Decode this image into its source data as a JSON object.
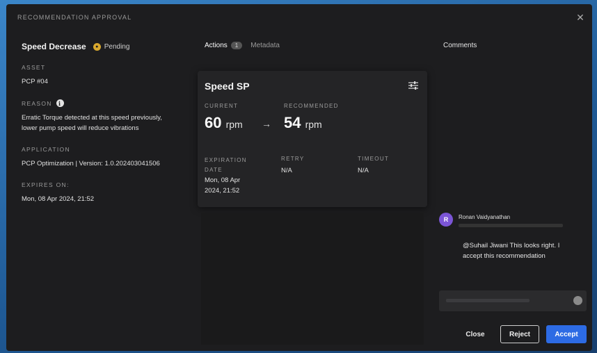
{
  "modal": {
    "title": "RECOMMENDATION APPROVAL",
    "close_icon": "close-icon"
  },
  "recommendation": {
    "name": "Speed Decrease",
    "status": "Pending"
  },
  "details": {
    "asset_label": "ASSET",
    "asset_value": "PCP #04",
    "reason_label": "REASON",
    "reason_value": "Erratic Torque detected at this speed previously, lower pump speed will reduce vibrations",
    "application_label": "APPLICATION",
    "application_value": "PCP Optimization | Version: 1.0.20240304​1506",
    "expires_label": "EXPIRES ON:",
    "expires_value": "Mon, 08 Apr 2024, 21:52"
  },
  "tabs": [
    {
      "label": "Actions",
      "count": "1"
    },
    {
      "label": "Metadata"
    }
  ],
  "action_card": {
    "title": "Speed SP",
    "current_label": "CURRENT",
    "current_value": "60",
    "current_unit": "rpm",
    "arrow": "→",
    "recommended_label": "RECOMMENDED",
    "recommended_value": "54",
    "recommended_unit": "rpm",
    "expiration_label": "EXPIRATION DATE",
    "expiration_value": "Mon, 08 Apr 2024, 21:52",
    "retry_label": "RETRY",
    "retry_value": "N/A",
    "timeout_label": "TIMEOUT",
    "timeout_value": "N/A"
  },
  "comments": {
    "heading": "Comments",
    "items": [
      {
        "initial": "R",
        "author": "Ronan Vaidyanathan",
        "text": "@Suhail Jiwani This looks right. I accept this recommendation"
      }
    ]
  },
  "footer": {
    "close_label": "Close",
    "reject_label": "Reject",
    "accept_label": "Accept"
  },
  "colors": {
    "accent": "#2d6be4",
    "pending": "#d9a82e",
    "avatar": "#7b55d6"
  }
}
